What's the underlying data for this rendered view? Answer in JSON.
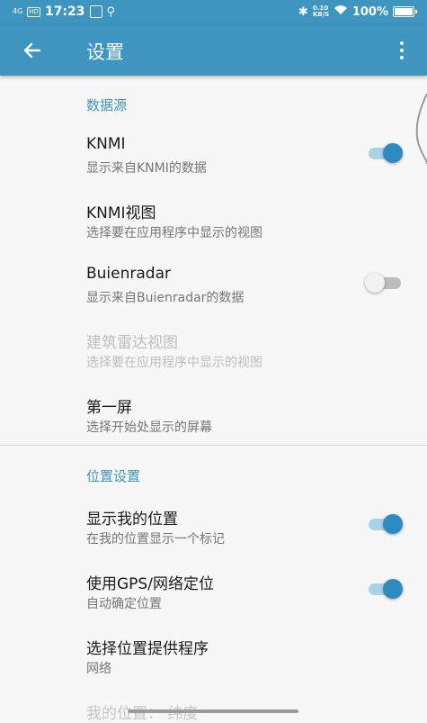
{
  "status_bar": {
    "network": "4G",
    "hd": "HD",
    "time": "17:23",
    "speed": "0.10 KB/S",
    "battery": "100%"
  },
  "app_bar": {
    "title": "设置",
    "icons": {
      "back": "arrow-left-icon",
      "more": "more-vert-icon"
    }
  },
  "sections": [
    {
      "header": "数据源",
      "items": [
        {
          "title": "KNMI",
          "subtitle": "显示来自KNMI的数据",
          "switch": "on"
        },
        {
          "title": "KNMI视图",
          "subtitle": "选择要在应用程序中显示的视图"
        },
        {
          "title": "Buienradar",
          "subtitle": "显示来自Buienradar的数据",
          "switch": "off"
        },
        {
          "title": "建筑雷达视图",
          "subtitle": "选择要在应用程序中显示的视图",
          "disabled": true
        },
        {
          "title": "第一屏",
          "subtitle": "选择开始处显示的屏幕"
        }
      ]
    },
    {
      "header": "位置设置",
      "items": [
        {
          "title": "显示我的位置",
          "subtitle": "在我的位置显示一个标记",
          "switch": "on"
        },
        {
          "title": "使用GPS/网络定位",
          "subtitle": "自动确定位置",
          "switch": "on"
        },
        {
          "title": "选择位置提供程序",
          "subtitle": "网络"
        },
        {
          "title": "我的位置： 纬度",
          "subtitle": ""
        }
      ]
    }
  ],
  "colors": {
    "accent": "#3e95bf",
    "switch_on": "#2e8bc2"
  }
}
